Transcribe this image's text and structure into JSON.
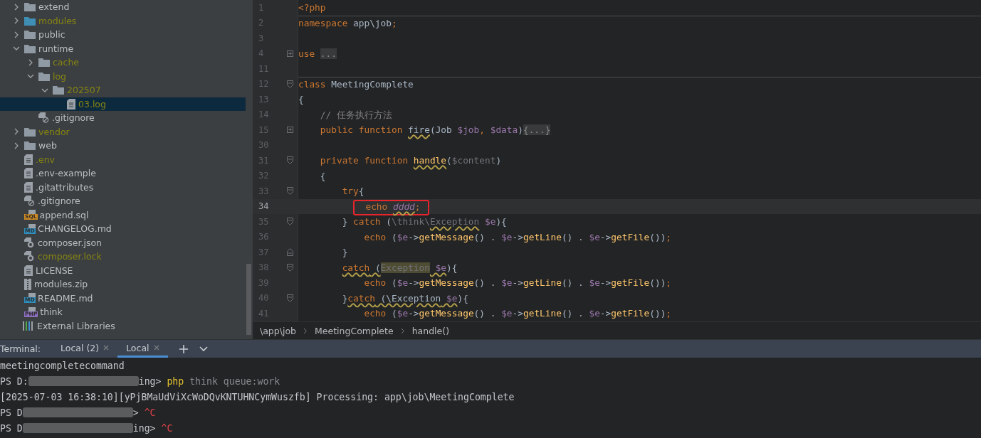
{
  "project_tree": [
    {
      "name": "extend",
      "kind": "folder",
      "ignored": false,
      "expanded": false,
      "selected": false
    },
    {
      "name": "modules",
      "kind": "module-folder",
      "ignored": true,
      "expanded": false,
      "selected": false
    },
    {
      "name": "public",
      "kind": "folder",
      "ignored": false,
      "expanded": false,
      "selected": false
    },
    {
      "name": "runtime",
      "kind": "folder",
      "ignored": false,
      "expanded": true,
      "selected": false,
      "children": [
        {
          "name": "cache",
          "kind": "folder",
          "ignored": true,
          "expanded": false,
          "selected": false
        },
        {
          "name": "log",
          "kind": "folder",
          "ignored": true,
          "expanded": true,
          "selected": false,
          "children": [
            {
              "name": "202507",
              "kind": "folder",
              "ignored": true,
              "expanded": true,
              "selected": false,
              "children": [
                {
                  "name": "03.log",
                  "kind": "text",
                  "ignored": true,
                  "selected": true
                }
              ]
            }
          ]
        },
        {
          "name": ".gitignore",
          "kind": "ignore",
          "ignored": false,
          "selected": false
        }
      ]
    },
    {
      "name": "vendor",
      "kind": "folder",
      "ignored": true,
      "expanded": false,
      "selected": false
    },
    {
      "name": "web",
      "kind": "folder",
      "ignored": false,
      "expanded": false,
      "selected": false
    },
    {
      "name": ".env",
      "kind": "text",
      "ignored": true,
      "selected": false
    },
    {
      "name": ".env-example",
      "kind": "text",
      "ignored": false,
      "selected": false
    },
    {
      "name": ".gitattributes",
      "kind": "text",
      "ignored": false,
      "selected": false
    },
    {
      "name": ".gitignore",
      "kind": "ignore",
      "ignored": false,
      "selected": false
    },
    {
      "name": "append.sql",
      "kind": "badge",
      "badge": "SQL",
      "color": "#d08b24",
      "ignored": false,
      "selected": false
    },
    {
      "name": "CHANGELOG.md",
      "kind": "badge",
      "badge": "MD",
      "color": "#2f8fbf",
      "ignored": false,
      "selected": false
    },
    {
      "name": "composer.json",
      "kind": "composer",
      "ignored": false,
      "selected": false
    },
    {
      "name": "composer.lock",
      "kind": "composer",
      "ignored": true,
      "selected": false
    },
    {
      "name": "LICENSE",
      "kind": "text",
      "ignored": false,
      "selected": false
    },
    {
      "name": "modules.zip",
      "kind": "zip",
      "ignored": false,
      "selected": false
    },
    {
      "name": "README.md",
      "kind": "badge",
      "badge": "MD",
      "color": "#2f8fbf",
      "ignored": false,
      "selected": false
    },
    {
      "name": "think",
      "kind": "badge",
      "badge": "PHP",
      "color": "#8e6fc1",
      "ignored": false,
      "selected": false
    },
    {
      "name": "External Libraries",
      "kind": "libraries",
      "ignored": false,
      "selected": false
    }
  ],
  "editor": {
    "lines": [
      {
        "number": "1",
        "tokens": [
          {
            "text": "<?php",
            "kind": "kw"
          }
        ]
      },
      {
        "number": "2",
        "separator": true,
        "tokens": [
          {
            "text": "namespace",
            "kind": "kw"
          },
          {
            "text": " app\\job",
            "kind": "plain"
          },
          {
            "text": ";",
            "kind": "kw"
          }
        ]
      },
      {
        "number": "3"
      },
      {
        "number": "4",
        "fold": {
          "kind": "plus"
        },
        "tokens": [
          {
            "text": "use ",
            "kind": "kw"
          },
          {
            "text": "...",
            "kind": "folded"
          }
        ]
      },
      {
        "number": "11"
      },
      {
        "number": "12",
        "fold": {
          "kind": "open"
        },
        "separator": true,
        "tokens": [
          {
            "text": "class",
            "kind": "kw"
          },
          {
            "text": " MeetingComplete",
            "kind": "plain"
          }
        ]
      },
      {
        "number": "13",
        "tokens": [
          {
            "text": "{",
            "kind": "plain"
          }
        ]
      },
      {
        "number": "14",
        "tokens": [
          {
            "text": "    // 任务执行方法",
            "kind": "comment"
          }
        ]
      },
      {
        "number": "15",
        "fold": {
          "kind": "plus"
        },
        "tokens": [
          {
            "text": "    public function ",
            "kind": "kw"
          },
          {
            "text": "fire",
            "kind": "plain",
            "underlined": true
          },
          {
            "text": "(Job ",
            "kind": "plain"
          },
          {
            "text": "$job",
            "kind": "var"
          },
          {
            "text": ", ",
            "kind": "kw"
          },
          {
            "text": "$data",
            "kind": "var"
          },
          {
            "text": ")",
            "kind": "plain"
          },
          {
            "text": "{...}",
            "kind": "folded"
          }
        ]
      },
      {
        "number": "30"
      },
      {
        "number": "31",
        "fold": {
          "kind": "open"
        },
        "tokens": [
          {
            "text": "    private function ",
            "kind": "kw"
          },
          {
            "text": "handle",
            "kind": "func",
            "underlined": true
          },
          {
            "text": "(",
            "kind": "plain"
          },
          {
            "text": "$content",
            "kind": "dim"
          },
          {
            "text": ")",
            "kind": "plain"
          }
        ]
      },
      {
        "number": "32",
        "tokens": [
          {
            "text": "    {",
            "kind": "plain"
          }
        ]
      },
      {
        "number": "33",
        "fold": {
          "kind": "open"
        },
        "tokens": [
          {
            "text": "        try",
            "kind": "kw"
          },
          {
            "text": "{",
            "kind": "plain"
          }
        ]
      },
      {
        "number": "34",
        "current": true,
        "annotated": true,
        "tokens": [
          {
            "text": "  echo ",
            "kind": "kw"
          },
          {
            "text": "dddd",
            "kind": "const",
            "underlined": true
          },
          {
            "text": ";",
            "kind": "kw"
          }
        ]
      },
      {
        "number": "35",
        "fold": {
          "kind": "open"
        },
        "tokens": [
          {
            "text": "        } ",
            "kind": "plain"
          },
          {
            "text": "catch",
            "kind": "kw"
          },
          {
            "text": " (",
            "kind": "plain"
          },
          {
            "text": "\\think\\",
            "kind": "dim"
          },
          {
            "text": "Exception",
            "kind": "dim",
            "underlined": true
          },
          {
            "text": " $e",
            "kind": "var"
          },
          {
            "text": "){",
            "kind": "plain"
          }
        ]
      },
      {
        "number": "36",
        "tokens": [
          {
            "text": "            echo",
            "kind": "kw"
          },
          {
            "text": " (",
            "kind": "plain"
          },
          {
            "text": "$e",
            "kind": "var"
          },
          {
            "text": "->",
            "kind": "plain"
          },
          {
            "text": "getMessage",
            "kind": "func"
          },
          {
            "text": "() . ",
            "kind": "plain"
          },
          {
            "text": "$e",
            "kind": "var"
          },
          {
            "text": "->",
            "kind": "plain"
          },
          {
            "text": "getLine",
            "kind": "func"
          },
          {
            "text": "() . ",
            "kind": "plain"
          },
          {
            "text": "$e",
            "kind": "var"
          },
          {
            "text": "->",
            "kind": "plain"
          },
          {
            "text": "getFile",
            "kind": "func"
          },
          {
            "text": "())",
            "kind": "plain"
          },
          {
            "text": ";",
            "kind": "kw"
          }
        ]
      },
      {
        "number": "37",
        "fold": {
          "kind": "close"
        },
        "tokens": [
          {
            "text": "        }",
            "kind": "plain"
          }
        ]
      },
      {
        "number": "38",
        "fold": {
          "kind": "open"
        },
        "tokens": [
          {
            "text": "        catch",
            "kind": "kw",
            "underlined": true
          },
          {
            "text": " (",
            "kind": "plain",
            "underlined": true
          },
          {
            "text": "Exception",
            "kind": "dim",
            "highlighted": true
          },
          {
            "text": " $e",
            "kind": "var",
            "underlined": true
          },
          {
            "text": "){",
            "kind": "plain"
          }
        ]
      },
      {
        "number": "39",
        "tokens": [
          {
            "text": "            echo",
            "kind": "kw"
          },
          {
            "text": " (",
            "kind": "plain"
          },
          {
            "text": "$e",
            "kind": "var"
          },
          {
            "text": "->",
            "kind": "plain"
          },
          {
            "text": "getMessage",
            "kind": "func"
          },
          {
            "text": "() . ",
            "kind": "plain"
          },
          {
            "text": "$e",
            "kind": "var"
          },
          {
            "text": "->",
            "kind": "plain"
          },
          {
            "text": "getLine",
            "kind": "func"
          },
          {
            "text": "() . ",
            "kind": "plain"
          },
          {
            "text": "$e",
            "kind": "var"
          },
          {
            "text": "->",
            "kind": "plain"
          },
          {
            "text": "getFile",
            "kind": "func"
          },
          {
            "text": "())",
            "kind": "plain"
          },
          {
            "text": ";",
            "kind": "kw"
          }
        ]
      },
      {
        "number": "40",
        "fold": {
          "kind": "open"
        },
        "tokens": [
          {
            "text": "        }",
            "kind": "plain"
          },
          {
            "text": "catch",
            "kind": "kw",
            "underlined": true
          },
          {
            "text": " (\\Exception",
            "kind": "plain",
            "underlined": true
          },
          {
            "text": " $e",
            "kind": "var",
            "underlined": true
          },
          {
            "text": "){",
            "kind": "plain"
          }
        ]
      },
      {
        "number": "41",
        "tokens": [
          {
            "text": "            echo",
            "kind": "kw"
          },
          {
            "text": " (",
            "kind": "plain"
          },
          {
            "text": "$e",
            "kind": "var"
          },
          {
            "text": "->",
            "kind": "plain"
          },
          {
            "text": "getMessage",
            "kind": "func"
          },
          {
            "text": "() . ",
            "kind": "plain"
          },
          {
            "text": "$e",
            "kind": "var"
          },
          {
            "text": "->",
            "kind": "plain"
          },
          {
            "text": "getLine",
            "kind": "func"
          },
          {
            "text": "() . ",
            "kind": "plain"
          },
          {
            "text": "$e",
            "kind": "var"
          },
          {
            "text": "->",
            "kind": "plain"
          },
          {
            "text": "getFile",
            "kind": "func"
          },
          {
            "text": "())",
            "kind": "plain"
          },
          {
            "text": ";",
            "kind": "kw"
          }
        ]
      }
    ],
    "breadcrumbs": [
      "\\app\\job",
      "MeetingComplete",
      "handle()"
    ]
  },
  "terminal": {
    "label": "Terminal:",
    "tabs": [
      {
        "label": "Local (2)",
        "selected": false
      },
      {
        "label": "Local",
        "selected": true
      }
    ],
    "lines": [
      [
        {
          "text": "meetingcompletecommand",
          "kind": "out"
        }
      ],
      [
        {
          "text": "PS D:",
          "kind": "out"
        },
        {
          "kind": "redacted"
        },
        {
          "text": "ing> ",
          "kind": "out"
        },
        {
          "text": "php",
          "kind": "cmd"
        },
        {
          "text": " think queue:work",
          "kind": "arg"
        }
      ],
      [
        {
          "text": "[2025-07-03 16:38:10][yPjBMaUdViXcWoDQvKNTUHNCymWuszfb] Processing: app\\job\\MeetingComplete",
          "kind": "out"
        }
      ],
      [
        {
          "text": "PS D",
          "kind": "out"
        },
        {
          "kind": "redacted"
        },
        {
          "text": "> ",
          "kind": "out"
        },
        {
          "text": "^C",
          "kind": "ctrl"
        }
      ],
      [
        {
          "text": "PS D",
          "kind": "out"
        },
        {
          "kind": "redacted"
        },
        {
          "text": "ing> ",
          "kind": "out"
        },
        {
          "text": "^C",
          "kind": "ctrl"
        }
      ]
    ]
  }
}
